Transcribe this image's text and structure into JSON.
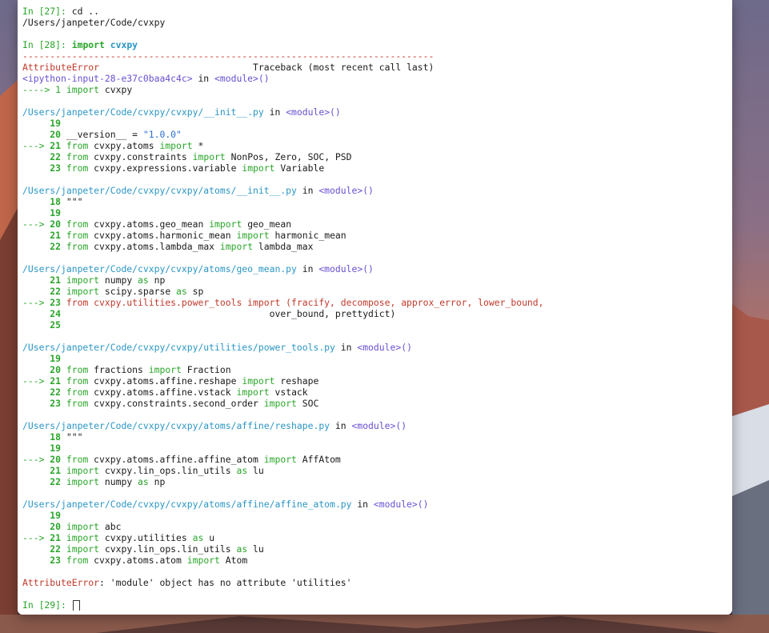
{
  "session": {
    "cells": [
      {
        "prompt": "In [27]:",
        "input": " cd ..",
        "output": "/Users/janpeter/Code/cvxpy"
      },
      {
        "prompt": "In [28]:",
        "input_kw": "import",
        "input_mod": "cvxpy"
      },
      {
        "prompt": "In [29]:",
        "input": ""
      }
    ],
    "separator": "---------------------------------------------------------------------------",
    "error_type": "AttributeError",
    "traceback_header": "Traceback (most recent call last)",
    "input_ref": "<ipython-input-28-e37c0baa4c4c>",
    "in_word": "in",
    "module_ref": "<module>()",
    "first_arrow_line": "----> 1 ",
    "first_arrow_code_kw": "import",
    "first_arrow_code": " cvxpy",
    "final_error_message": ": 'module' object has no attribute 'utilities'"
  },
  "frames": [
    {
      "path": "/Users/janpeter/Code/cvxpy/cvxpy/__init__.py",
      "lines": [
        {
          "marker": "     ",
          "no": "19",
          "code": ""
        },
        {
          "marker": "     ",
          "no": "20",
          "code": " __version__ = ",
          "str": "\"1.0.0\""
        },
        {
          "marker": "---> ",
          "no": "21",
          "kw1": " from",
          "code": " cvxpy.atoms ",
          "kw2": "import",
          "rest": " *"
        },
        {
          "marker": "     ",
          "no": "22",
          "kw1": " from",
          "code": " cvxpy.constraints ",
          "kw2": "import",
          "rest": " NonPos, Zero, SOC, PSD"
        },
        {
          "marker": "     ",
          "no": "23",
          "kw1": " from",
          "code": " cvxpy.expressions.variable ",
          "kw2": "import",
          "rest": " Variable"
        }
      ]
    },
    {
      "path": "/Users/janpeter/Code/cvxpy/cvxpy/atoms/__init__.py",
      "lines": [
        {
          "marker": "     ",
          "no": "18",
          "code": " \"\"\""
        },
        {
          "marker": "     ",
          "no": "19",
          "code": ""
        },
        {
          "marker": "---> ",
          "no": "20",
          "kw1": " from",
          "code": " cvxpy.atoms.geo_mean ",
          "kw2": "import",
          "rest": " geo_mean"
        },
        {
          "marker": "     ",
          "no": "21",
          "kw1": " from",
          "code": " cvxpy.atoms.harmonic_mean ",
          "kw2": "import",
          "rest": " harmonic_mean"
        },
        {
          "marker": "     ",
          "no": "22",
          "kw1": " from",
          "code": " cvxpy.atoms.lambda_max ",
          "kw2": "import",
          "rest": " lambda_max"
        }
      ]
    },
    {
      "path": "/Users/janpeter/Code/cvxpy/cvxpy/atoms/geo_mean.py",
      "lines": [
        {
          "marker": "     ",
          "no": "21",
          "kw1": " import",
          "code": " numpy ",
          "kw2": "as",
          "rest": " np"
        },
        {
          "marker": "     ",
          "no": "22",
          "kw1": " import",
          "code": " scipy.sparse ",
          "kw2": "as",
          "rest": " sp"
        },
        {
          "marker": "---> ",
          "no": "23",
          "red": " from cvxpy.utilities.power_tools import (fracify, decompose, approx_error, lower_bound,"
        },
        {
          "marker": "     ",
          "no": "24",
          "code": "                                      over_bound, prettydict)"
        },
        {
          "marker": "     ",
          "no": "25",
          "code": ""
        }
      ]
    },
    {
      "path": "/Users/janpeter/Code/cvxpy/cvxpy/utilities/power_tools.py",
      "lines": [
        {
          "marker": "     ",
          "no": "19",
          "code": ""
        },
        {
          "marker": "     ",
          "no": "20",
          "kw1": " from",
          "code": " fractions ",
          "kw2": "import",
          "rest": " Fraction"
        },
        {
          "marker": "---> ",
          "no": "21",
          "kw1": " from",
          "code": " cvxpy.atoms.affine.reshape ",
          "kw2": "import",
          "rest": " reshape"
        },
        {
          "marker": "     ",
          "no": "22",
          "kw1": " from",
          "code": " cvxpy.atoms.affine.vstack ",
          "kw2": "import",
          "rest": " vstack"
        },
        {
          "marker": "     ",
          "no": "23",
          "kw1": " from",
          "code": " cvxpy.constraints.second_order ",
          "kw2": "import",
          "rest": " SOC"
        }
      ]
    },
    {
      "path": "/Users/janpeter/Code/cvxpy/cvxpy/atoms/affine/reshape.py",
      "lines": [
        {
          "marker": "     ",
          "no": "18",
          "code": " \"\"\""
        },
        {
          "marker": "     ",
          "no": "19",
          "code": ""
        },
        {
          "marker": "---> ",
          "no": "20",
          "kw1": " from",
          "code": " cvxpy.atoms.affine.affine_atom ",
          "kw2": "import",
          "rest": " AffAtom"
        },
        {
          "marker": "     ",
          "no": "21",
          "kw1": " import",
          "code": " cvxpy.lin_ops.lin_utils ",
          "kw2": "as",
          "rest": " lu"
        },
        {
          "marker": "     ",
          "no": "22",
          "kw1": " import",
          "code": " numpy ",
          "kw2": "as",
          "rest": " np"
        }
      ]
    },
    {
      "path": "/Users/janpeter/Code/cvxpy/cvxpy/atoms/affine/affine_atom.py",
      "lines": [
        {
          "marker": "     ",
          "no": "19",
          "code": ""
        },
        {
          "marker": "     ",
          "no": "20",
          "kw1": " import",
          "code": " abc"
        },
        {
          "marker": "---> ",
          "no": "21",
          "kw1": " import",
          "code": " cvxpy.utilities ",
          "kw2": "as",
          "rest": " u"
        },
        {
          "marker": "     ",
          "no": "22",
          "kw1": " import",
          "code": " cvxpy.lin_ops.lin_utils ",
          "kw2": "as",
          "rest": " lu"
        },
        {
          "marker": "     ",
          "no": "23",
          "kw1": " from",
          "code": " cvxpy.atoms.atom ",
          "kw2": "import",
          "rest": " Atom"
        }
      ]
    }
  ]
}
